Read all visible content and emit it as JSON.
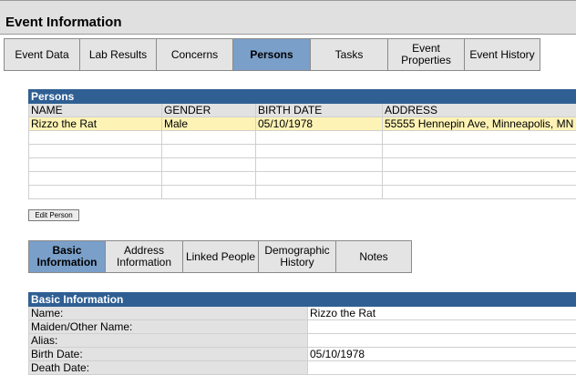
{
  "window": {
    "title": "Event Information"
  },
  "main_tabs": [
    {
      "label": "Event Data"
    },
    {
      "label": "Lab Results"
    },
    {
      "label": "Concerns"
    },
    {
      "label": "Persons"
    },
    {
      "label": "Tasks"
    },
    {
      "label": "Event Properties"
    },
    {
      "label": "Event History"
    }
  ],
  "persons": {
    "title": "Persons",
    "columns": [
      "NAME",
      "GENDER",
      "BIRTH DATE",
      "ADDRESS"
    ],
    "rows": [
      [
        "Rizzo the Rat",
        "Male",
        "05/10/1978",
        "55555 Hennepin Ave, Minneapolis, MN"
      ],
      [
        "",
        "",
        "",
        ""
      ],
      [
        "",
        "",
        "",
        ""
      ],
      [
        "",
        "",
        "",
        ""
      ],
      [
        "",
        "",
        "",
        ""
      ],
      [
        "",
        "",
        "",
        ""
      ]
    ],
    "edit_button": "Edit Person"
  },
  "sub_tabs": [
    {
      "label": "Basic Information"
    },
    {
      "label": "Address Information"
    },
    {
      "label": "Linked People"
    },
    {
      "label": "Demographic History"
    },
    {
      "label": "Notes"
    }
  ],
  "basic_info": {
    "title": "Basic Information",
    "fields": [
      {
        "label": "Name:",
        "value": "Rizzo the Rat"
      },
      {
        "label": "Maiden/Other Name:",
        "value": ""
      },
      {
        "label": "Alias:",
        "value": ""
      },
      {
        "label": "Birth Date:",
        "value": "05/10/1978"
      },
      {
        "label": "Death Date:",
        "value": ""
      }
    ]
  }
}
